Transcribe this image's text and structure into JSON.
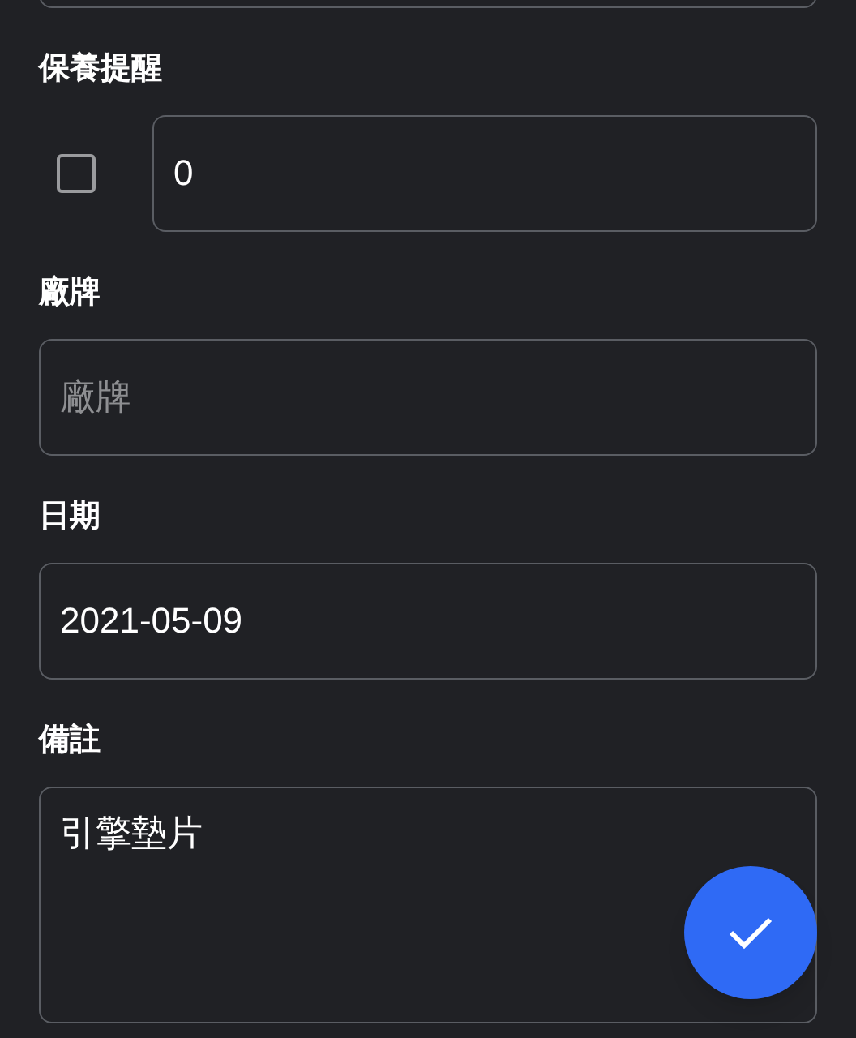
{
  "fields": [
    {
      "kind": "cut_off"
    },
    {
      "kind": "checkbox_number",
      "label": "保養提醒",
      "checked": false,
      "value": "0"
    },
    {
      "kind": "text",
      "label": "廠牌",
      "placeholder": "廠牌"
    },
    {
      "kind": "text",
      "label": "日期",
      "value": "2021-05-09"
    },
    {
      "kind": "textarea",
      "label": "備註",
      "value": "引擎墊片"
    }
  ]
}
